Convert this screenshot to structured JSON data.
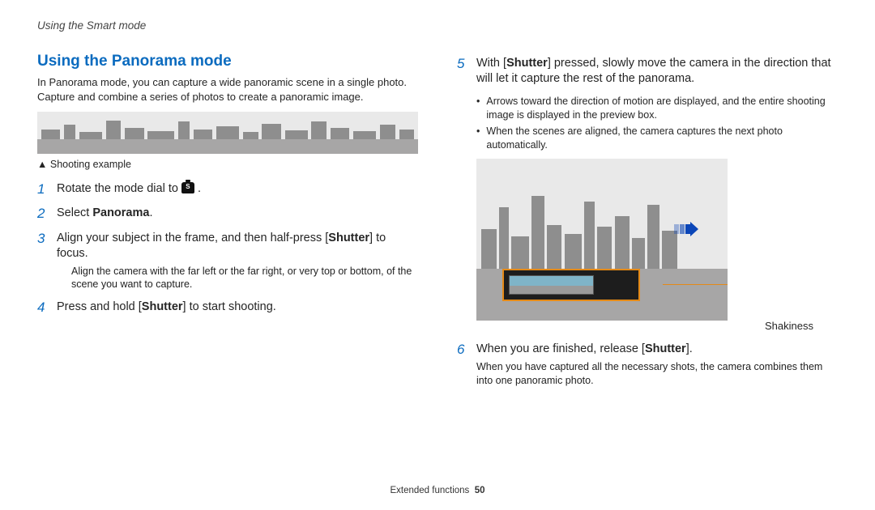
{
  "header": "Using the Smart mode",
  "title": "Using the Panorama mode",
  "intro": "In Panorama mode, you can capture a wide panoramic scene in a single photo. Capture and combine a series of photos to create a panoramic image.",
  "example_caption": "Shooting example",
  "steps": {
    "s1_pre": "Rotate the mode dial to ",
    "s1_post": " .",
    "s2_pre": "Select ",
    "s2_bold": "Panorama",
    "s2_post": ".",
    "s3_a": "Align your subject in the frame, and then half-press [",
    "s3_b": "Shutter",
    "s3_c": "] to focus.",
    "s3_note": "Align the camera with the far left or the far right, or very top or bottom, of the scene you want to capture.",
    "s4_a": "Press and hold [",
    "s4_b": "Shutter",
    "s4_c": "] to start shooting.",
    "s5_a": "With [",
    "s5_b": "Shutter",
    "s5_c": "] pressed, slowly move the camera in the direction that will let it capture the rest of the panorama.",
    "s5_bullets": [
      "Arrows toward the direction of motion are displayed, and the entire shooting image is displayed in the preview box.",
      "When the scenes are aligned, the camera captures the next photo automatically."
    ],
    "s6_a": "When you are finished, release [",
    "s6_b": "Shutter",
    "s6_c": "].",
    "s6_note": "When you have captured all the necessary shots, the camera combines them into one panoramic photo."
  },
  "shakiness_label": "Shakiness",
  "footer_section": "Extended functions",
  "footer_page": "50"
}
